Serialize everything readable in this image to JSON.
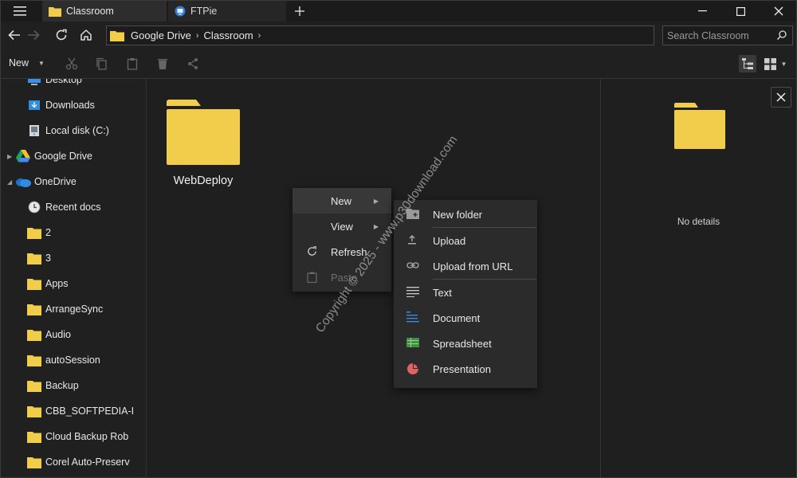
{
  "titlebar": {
    "tabs": [
      {
        "label": "Classroom",
        "active": true
      },
      {
        "label": "FTPie",
        "active": false
      }
    ]
  },
  "address": {
    "breadcrumb": [
      "Google Drive",
      "Classroom"
    ],
    "search_placeholder": "Search Classroom"
  },
  "toolbar": {
    "new_label": "New"
  },
  "sidebar": {
    "items": [
      {
        "label": "Desktop",
        "icon": "desktop-icon"
      },
      {
        "label": "Downloads",
        "icon": "downloads-icon"
      },
      {
        "label": "Local disk (C:)",
        "icon": "disk-icon"
      },
      {
        "label": "Google Drive",
        "icon": "google-drive-icon"
      },
      {
        "label": "OneDrive",
        "icon": "onedrive-icon"
      },
      {
        "label": "Recent docs",
        "icon": "clock-icon"
      },
      {
        "label": "2",
        "icon": "folder-icon"
      },
      {
        "label": "3",
        "icon": "folder-icon"
      },
      {
        "label": "Apps",
        "icon": "folder-icon"
      },
      {
        "label": "ArrangeSync",
        "icon": "folder-icon"
      },
      {
        "label": "Audio",
        "icon": "folder-icon"
      },
      {
        "label": "autoSession",
        "icon": "folder-icon"
      },
      {
        "label": "Backup",
        "icon": "folder-icon"
      },
      {
        "label": "CBB_SOFTPEDIA-I",
        "icon": "folder-icon"
      },
      {
        "label": "Cloud Backup Rob",
        "icon": "folder-icon"
      },
      {
        "label": "Corel Auto-Preserv",
        "icon": "folder-icon"
      }
    ]
  },
  "content": {
    "items": [
      {
        "label": "WebDeploy",
        "icon": "folder-icon"
      }
    ]
  },
  "details": {
    "empty_text": "No details"
  },
  "context_menu": {
    "items": [
      {
        "label": "New",
        "submenu": true
      },
      {
        "label": "View",
        "submenu": true
      },
      {
        "label": "Refresh",
        "icon": "refresh-icon"
      },
      {
        "label": "Paste",
        "icon": "paste-icon",
        "disabled": true
      }
    ]
  },
  "new_submenu": {
    "items": [
      {
        "label": "New folder",
        "icon": "new-folder-icon"
      },
      {
        "label": "Upload",
        "icon": "upload-icon"
      },
      {
        "label": "Upload from URL",
        "icon": "link-icon"
      },
      {
        "label": "Text",
        "icon": "text-icon"
      },
      {
        "label": "Document",
        "icon": "document-icon"
      },
      {
        "label": "Spreadsheet",
        "icon": "spreadsheet-icon"
      },
      {
        "label": "Presentation",
        "icon": "presentation-icon"
      }
    ]
  },
  "watermark": "Copyright © 2025 - www.p30download.com",
  "colors": {
    "folder": "#f2cd4b",
    "background": "#1f1f1f",
    "accent_blue": "#3a8ee6"
  }
}
